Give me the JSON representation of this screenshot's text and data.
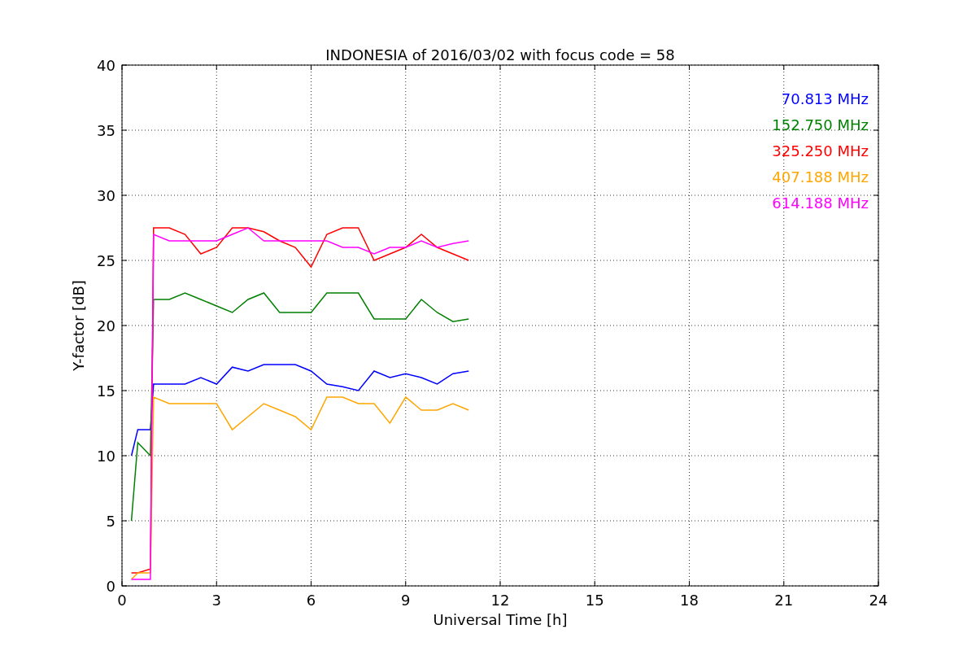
{
  "figure": {
    "chart_data": {
      "type": "line",
      "title": "INDONESIA of 2016/03/02 with focus code = 58",
      "xlabel": "Universal Time [h]",
      "ylabel": "Y-factor [dB]",
      "xlim": [
        0,
        24
      ],
      "ylim": [
        0,
        40
      ],
      "xticks": [
        0,
        3,
        6,
        9,
        12,
        15,
        18,
        21,
        24
      ],
      "yticks": [
        0,
        5,
        10,
        15,
        20,
        25,
        30,
        35,
        40
      ],
      "grid": true,
      "x": [
        0.3,
        0.5,
        0.9,
        1.0,
        1.5,
        2,
        2.5,
        3,
        3.5,
        4,
        4.5,
        5,
        5.5,
        6,
        6.5,
        7,
        7.5,
        8,
        8.5,
        9,
        9.5,
        10,
        10.5,
        11
      ],
      "series": [
        {
          "name": "70.813 MHz",
          "color": "#0000ff",
          "values": [
            10,
            12,
            12,
            15.5,
            15.5,
            15.5,
            16,
            15.5,
            16.8,
            16.5,
            17,
            17,
            17,
            16.5,
            15.5,
            15.3,
            15,
            16.5,
            16,
            16.3,
            16,
            15.5,
            16.3,
            16.5
          ]
        },
        {
          "name": "152.750 MHz",
          "color": "#008000",
          "values": [
            5,
            11,
            10,
            22,
            22,
            22.5,
            22,
            21.5,
            21,
            22,
            22.5,
            21,
            21,
            21,
            22.5,
            22.5,
            22.5,
            20.5,
            20.5,
            20.5,
            22,
            21,
            20.3,
            20.5
          ]
        },
        {
          "name": "325.250 MHz",
          "color": "#ff0000",
          "values": [
            1,
            1,
            1.3,
            27.5,
            27.5,
            27,
            25.5,
            26,
            27.5,
            27.5,
            27.2,
            26.5,
            26,
            24.5,
            27,
            27.5,
            27.5,
            25,
            25.5,
            26,
            27,
            26,
            25.5,
            25
          ]
        },
        {
          "name": "407.188 MHz",
          "color": "#ffa500",
          "values": [
            0.5,
            1,
            1,
            14.5,
            14,
            14,
            14,
            14,
            12,
            13,
            14,
            13.5,
            13,
            12,
            14.5,
            14.5,
            14,
            14,
            12.5,
            14.5,
            13.5,
            13.5,
            14,
            13.5
          ]
        },
        {
          "name": "614.188 MHz",
          "color": "#ff00ff",
          "values": [
            0.5,
            0.5,
            0.5,
            27,
            26.5,
            26.5,
            26.5,
            26.5,
            27,
            27.5,
            26.5,
            26.5,
            26.5,
            26.5,
            26.5,
            26,
            26,
            25.5,
            26,
            26,
            26.5,
            26,
            26.3,
            26.5
          ]
        }
      ]
    }
  }
}
